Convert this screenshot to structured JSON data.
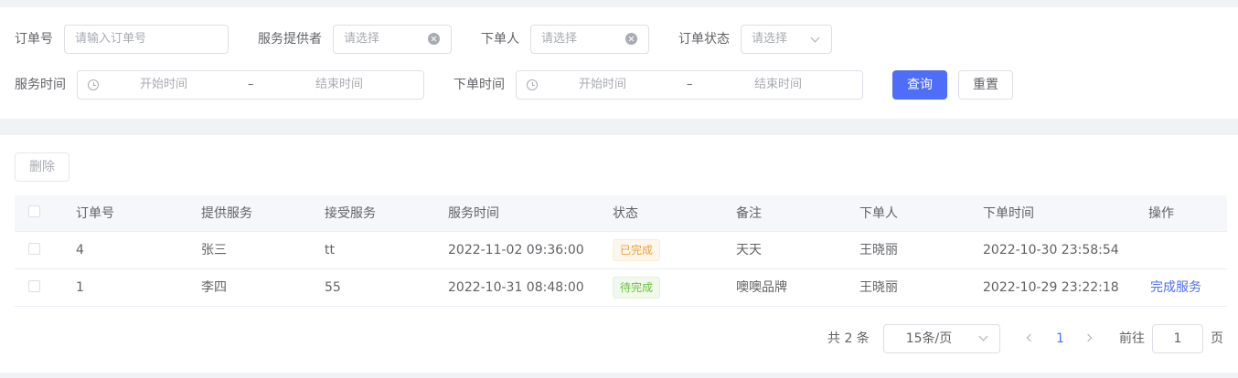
{
  "filters": {
    "order_no": {
      "label": "订单号",
      "placeholder": "请输入订单号"
    },
    "provider": {
      "label": "服务提供者",
      "placeholder": "请选择"
    },
    "orderer": {
      "label": "下单人",
      "placeholder": "请选择"
    },
    "status": {
      "label": "订单状态",
      "placeholder": "请选择"
    },
    "service_time": {
      "label": "服务时间",
      "start_placeholder": "开始时间",
      "separator": "–",
      "end_placeholder": "结束时间"
    },
    "order_time": {
      "label": "下单时间",
      "start_placeholder": "开始时间",
      "separator": "–",
      "end_placeholder": "结束时间"
    },
    "query_label": "查询",
    "reset_label": "重置"
  },
  "toolbar": {
    "delete_label": "删除"
  },
  "table": {
    "headers": [
      "订单号",
      "提供服务",
      "接受服务",
      "服务时间",
      "状态",
      "备注",
      "下单人",
      "下单时间",
      "操作"
    ],
    "rows": [
      {
        "order_no": "4",
        "provide": "张三",
        "receive": "tt",
        "service_time": "2022-11-02 09:36:00",
        "status": "已完成",
        "status_type": "warning",
        "remark": "天天",
        "orderer": "王晓丽",
        "order_time": "2022-10-30 23:58:54",
        "action": ""
      },
      {
        "order_no": "1",
        "provide": "李四",
        "receive": "55",
        "service_time": "2022-10-31 08:48:00",
        "status": "待完成",
        "status_type": "success",
        "remark": "噢噢品牌",
        "orderer": "王晓丽",
        "order_time": "2022-10-29 23:22:18",
        "action": "完成服务"
      }
    ]
  },
  "pagination": {
    "total_text": "共 2 条",
    "page_size": "15条/页",
    "current_page": "1",
    "goto_label": "前往",
    "goto_value": "1",
    "page_suffix": "页"
  },
  "colors": {
    "primary": "#4f6ef7",
    "warning": "#e6a23c",
    "success": "#67c23a"
  }
}
